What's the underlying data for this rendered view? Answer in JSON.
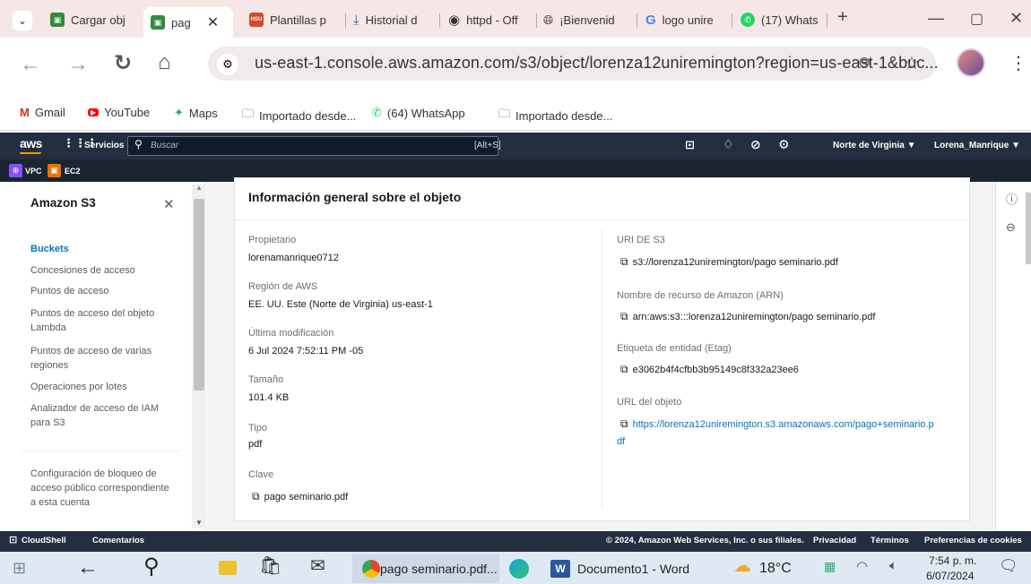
{
  "browser": {
    "tabs": [
      {
        "label": "Cargar obj",
        "color": "#2e8b3a"
      },
      {
        "label": "pag",
        "color": "#2e8b3a"
      },
      {
        "label": "Plantillas p",
        "color": "#d04a2a"
      },
      {
        "label": "Historial d",
        "color": "#1a63c6"
      },
      {
        "label": "httpd - Off",
        "color": "#333333"
      },
      {
        "label": "¡Bienvenid",
        "color": "#333333"
      },
      {
        "label": "logo unire",
        "color": "#4285f4"
      },
      {
        "label": "(17) Whats",
        "color": "#25d366"
      }
    ],
    "tab_icon_text": {
      "plantillas": "HSU"
    },
    "url": "us-east-1.console.aws.amazon.com/s3/object/lorenza12uniremington?region=us-east-1&buc...",
    "bookmarks": [
      "Gmail",
      "YouTube",
      "Maps",
      "Importado desde...",
      "(64) WhatsApp",
      "Importado desde..."
    ]
  },
  "aws": {
    "logo": "aws",
    "services": "Servicios",
    "search_placeholder": "Buscar",
    "search_shortcut": "[Alt+S]",
    "region": "Norte de Virginia ▼",
    "user": "Lorena_Manrique ▼",
    "favorites": [
      "VPC",
      "EC2"
    ]
  },
  "sidebar": {
    "title": "Amazon S3",
    "items": [
      "Buckets",
      "Concesiones de acceso",
      "Puntos de acceso",
      "Puntos de acceso del objeto Lambda",
      "Puntos de acceso de varias regiones",
      "Operaciones por lotes",
      "Analizador de acceso de IAM para S3",
      "Configuración de bloqueo de acceso público correspondiente a esta cuenta"
    ]
  },
  "panel": {
    "title": "Información general sobre el objeto",
    "left": [
      {
        "label": "Propietario",
        "value": "lorenamanrique0712"
      },
      {
        "label": "Región de AWS",
        "value": "EE. UU. Este (Norte de Virginia) us-east-1"
      },
      {
        "label": "Última modificación",
        "value": "6 Jul 2024 7:52:11 PM -05"
      },
      {
        "label": "Tamaño",
        "value": "101.4 KB"
      },
      {
        "label": "Tipo",
        "value": "pdf"
      },
      {
        "label": "Clave",
        "value": "pago seminario.pdf"
      }
    ],
    "right": [
      {
        "label": "URI DE S3",
        "value": "s3://lorenza12uniremington/pago seminario.pdf"
      },
      {
        "label": "Nombre de recurso de Amazon (ARN)",
        "value": "arn:aws:s3:::lorenza12uniremington/pago seminario.pdf"
      },
      {
        "label": "Etiqueta de entidad (Etag)",
        "value": "e3062b4f4cfbb3b95149c8f332a23ee6"
      },
      {
        "label": "URL del objeto",
        "value": "https://lorenza12uniremington.s3.amazonaws.com/pago+seminario.p",
        "value2": "df"
      }
    ]
  },
  "footer": {
    "cloudshell": "CloudShell",
    "comentarios": "Comentarios",
    "copyright": "© 2024, Amazon Web Services, Inc. o sus filiales.",
    "privacidad": "Privacidad",
    "terminos": "Términos",
    "cookies": "Preferencias de cookies"
  },
  "taskbar": {
    "chrome_window": "pago seminario.pdf...",
    "word_window": "Documento1 - Word",
    "temperature": "18°C",
    "time": "7:54 p. m.",
    "date": "6/07/2024"
  }
}
